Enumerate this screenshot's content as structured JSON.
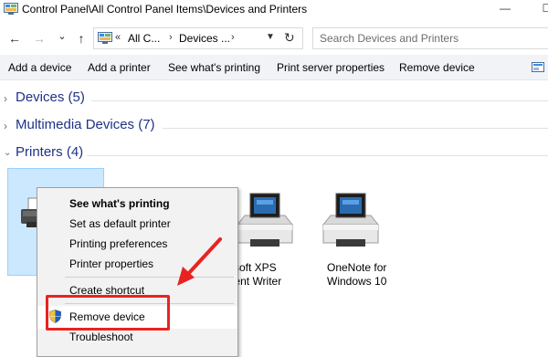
{
  "window": {
    "title": "Control Panel\\All Control Panel Items\\Devices and Printers",
    "minimize": "—",
    "maximize": "☐"
  },
  "nav": {
    "back": "←",
    "forward": "→",
    "recent": "⌄",
    "up": "↑",
    "address_chevrons": "«",
    "crumbs": [
      "All C...",
      "Devices ..."
    ],
    "crumb_sep": "›",
    "refresh": "↻",
    "search_placeholder": "Search Devices and Printers"
  },
  "toolbar": {
    "items": [
      "Add a device",
      "Add a printer",
      "See what's printing",
      "Print server properties",
      "Remove device"
    ]
  },
  "groups": [
    {
      "label": "Devices (5)",
      "expanded": false
    },
    {
      "label": "Multimedia Devices (7)",
      "expanded": false
    },
    {
      "label": "Printers (4)",
      "expanded": true
    }
  ],
  "printers": [
    {
      "label_line1": "",
      "label_line2": "",
      "selected": true
    },
    {
      "label_line1": "rosoft XPS",
      "label_line2": "ument Writer",
      "selected": false
    },
    {
      "label_line1": "OneNote for",
      "label_line2": "Windows 10",
      "selected": false
    }
  ],
  "context_menu": {
    "items": [
      {
        "label": "See what's printing",
        "bold": true
      },
      {
        "label": "Set as default printer"
      },
      {
        "label": "Printing preferences"
      },
      {
        "label": "Printer properties"
      },
      {
        "label": "Create shortcut"
      },
      {
        "label": "Remove device",
        "highlighted": true,
        "icon": "uac-shield-icon"
      },
      {
        "label": "Troubleshoot"
      }
    ]
  },
  "colors": {
    "group_title": "#1e3287",
    "selection": "#cce8ff",
    "annotation": "#e8231f"
  }
}
